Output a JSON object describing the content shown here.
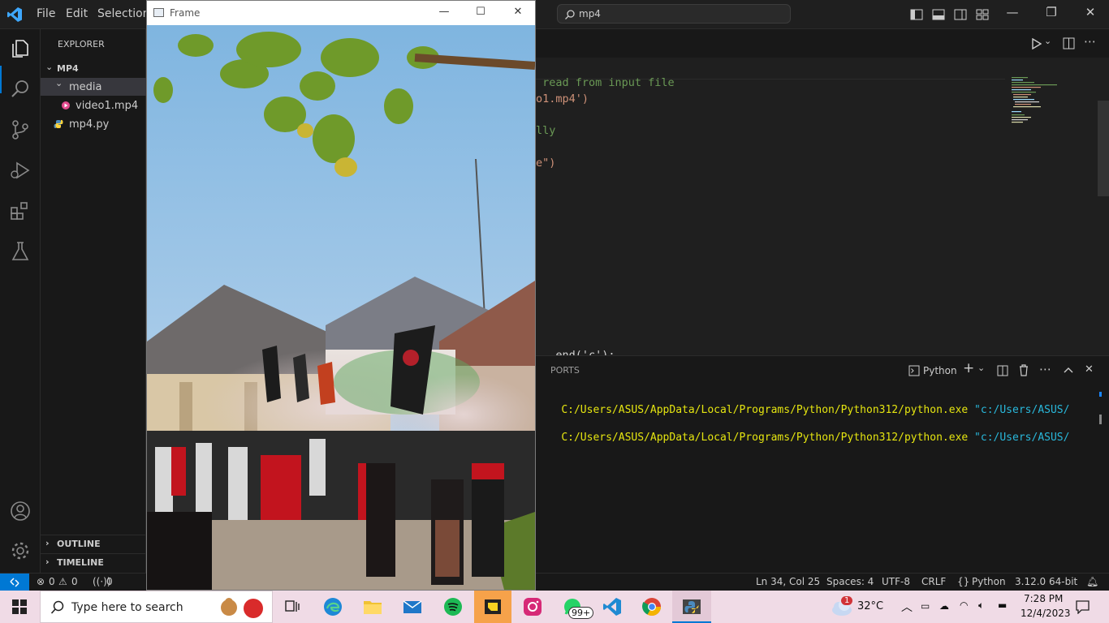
{
  "menubar": {
    "file": "File",
    "edit": "Edit",
    "selection": "Selection"
  },
  "command_center": {
    "text": "mp4"
  },
  "explorer": {
    "title": "EXPLORER",
    "root": "MP4",
    "folder": "media",
    "file_video": "video1.mp4",
    "file_py": "mp4.py",
    "outline": "OUTLINE",
    "timeline": "TIMELINE"
  },
  "editor": {
    "lines": [
      {
        "text": " read from input file",
        "cls": "green"
      },
      {
        "text": "o1.mp4')",
        "cls": "orange"
      },
      {
        "text": "lly",
        "cls": "green"
      },
      {
        "text": "e\")",
        "cls": "orange"
      },
      {
        "text": "—— end('c'):",
        "cls": "white"
      }
    ]
  },
  "panel": {
    "ports_tab": "PORTS",
    "terminal_kind": "Python",
    "terminal_lines": [
      {
        "path": "C:/Users/ASUS/AppData/Local/Programs/Python/Python312/python.exe",
        "arg": "\"c:/Users/ASUS/"
      },
      {
        "path": "C:/Users/ASUS/AppData/Local/Programs/Python/Python312/python.exe",
        "arg": "\"c:/Users/ASUS/"
      }
    ]
  },
  "statusbar": {
    "errors": "0",
    "warnings": "0",
    "ports": "0",
    "position": "Ln 34, Col 25",
    "spaces": "Spaces: 4",
    "encoding": "UTF-8",
    "eol": "CRLF",
    "language": "Python",
    "interpreter": "3.12.0 64-bit"
  },
  "frame_window": {
    "title": "Frame"
  },
  "taskbar": {
    "search_placeholder": "Type here to search",
    "whatsapp_badge": "99+",
    "weather_badge": "1",
    "temperature": "32°C",
    "time": "7:28 PM",
    "date": "12/4/2023"
  },
  "colors": {
    "accent": "#0078d4",
    "editor_bg": "#1f1f1f",
    "taskbar_bg": "#f0dbe6"
  }
}
